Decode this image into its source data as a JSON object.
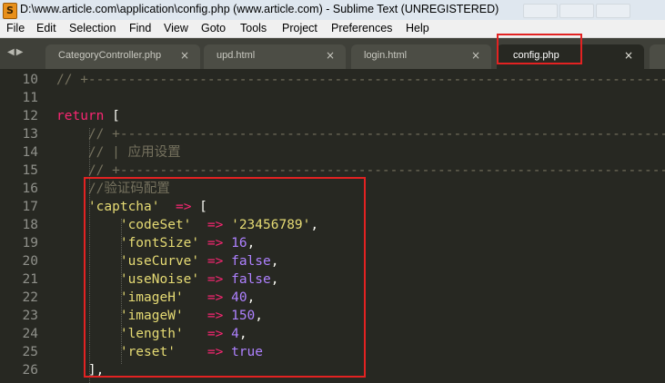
{
  "window": {
    "title": "D:\\www.article.com\\application\\config.php (www.article.com) - Sublime Text (UNREGISTERED)",
    "app_icon": "S"
  },
  "menu": [
    "File",
    "Edit",
    "Selection",
    "Find",
    "View",
    "Goto",
    "Tools",
    "Project",
    "Preferences",
    "Help"
  ],
  "tabs": [
    {
      "label": "CategoryController.php",
      "close": "×",
      "active": false
    },
    {
      "label": "upd.html",
      "close": "×",
      "active": false
    },
    {
      "label": "login.html",
      "close": "×",
      "active": false
    },
    {
      "label": "config.php",
      "close": "×",
      "active": true
    }
  ],
  "nav_arrows": "◀▶",
  "colors": {
    "comment": "#75715e",
    "keyword": "#f92672",
    "string": "#e6db74",
    "number": "#ae81ff",
    "plain": "#f8f8f2",
    "highlight": "#e32222"
  },
  "editor": {
    "lines": [
      {
        "n": "10",
        "tokens": [
          {
            "t": "// +-----------------------------------------------------------------------------",
            "c": "cm"
          }
        ]
      },
      {
        "n": "11",
        "tokens": []
      },
      {
        "n": "12",
        "tokens": [
          {
            "t": "return",
            "c": "kw"
          },
          {
            "t": " [",
            "c": "pl"
          }
        ]
      },
      {
        "n": "13",
        "tokens": [
          {
            "t": "    // +------------------------------------------------------------------------",
            "c": "cm"
          }
        ]
      },
      {
        "n": "14",
        "tokens": [
          {
            "t": "    // | 应用设置",
            "c": "cm"
          }
        ]
      },
      {
        "n": "15",
        "tokens": [
          {
            "t": "    // +------------------------------------------------------------------------",
            "c": "cm"
          }
        ]
      },
      {
        "n": "16",
        "tokens": [
          {
            "t": "    //验证码配置",
            "c": "cm"
          }
        ]
      },
      {
        "n": "17",
        "tokens": [
          {
            "t": "    ",
            "c": "pl"
          },
          {
            "t": "'captcha'",
            "c": "str"
          },
          {
            "t": "  ",
            "c": "pl"
          },
          {
            "t": "=>",
            "c": "op"
          },
          {
            "t": " [",
            "c": "pl"
          }
        ]
      },
      {
        "n": "18",
        "tokens": [
          {
            "t": "        ",
            "c": "pl"
          },
          {
            "t": "'codeSet'",
            "c": "str"
          },
          {
            "t": "  ",
            "c": "pl"
          },
          {
            "t": "=>",
            "c": "op"
          },
          {
            "t": " ",
            "c": "pl"
          },
          {
            "t": "'23456789'",
            "c": "str"
          },
          {
            "t": ",",
            "c": "pl"
          }
        ]
      },
      {
        "n": "19",
        "tokens": [
          {
            "t": "        ",
            "c": "pl"
          },
          {
            "t": "'fontSize'",
            "c": "str"
          },
          {
            "t": " ",
            "c": "pl"
          },
          {
            "t": "=>",
            "c": "op"
          },
          {
            "t": " ",
            "c": "pl"
          },
          {
            "t": "16",
            "c": "num"
          },
          {
            "t": ",",
            "c": "pl"
          }
        ]
      },
      {
        "n": "20",
        "tokens": [
          {
            "t": "        ",
            "c": "pl"
          },
          {
            "t": "'useCurve'",
            "c": "str"
          },
          {
            "t": " ",
            "c": "pl"
          },
          {
            "t": "=>",
            "c": "op"
          },
          {
            "t": " ",
            "c": "pl"
          },
          {
            "t": "false",
            "c": "num"
          },
          {
            "t": ",",
            "c": "pl"
          }
        ]
      },
      {
        "n": "21",
        "tokens": [
          {
            "t": "        ",
            "c": "pl"
          },
          {
            "t": "'useNoise'",
            "c": "str"
          },
          {
            "t": " ",
            "c": "pl"
          },
          {
            "t": "=>",
            "c": "op"
          },
          {
            "t": " ",
            "c": "pl"
          },
          {
            "t": "false",
            "c": "num"
          },
          {
            "t": ",",
            "c": "pl"
          }
        ]
      },
      {
        "n": "22",
        "tokens": [
          {
            "t": "        ",
            "c": "pl"
          },
          {
            "t": "'imageH'",
            "c": "str"
          },
          {
            "t": "   ",
            "c": "pl"
          },
          {
            "t": "=>",
            "c": "op"
          },
          {
            "t": " ",
            "c": "pl"
          },
          {
            "t": "40",
            "c": "num"
          },
          {
            "t": ",",
            "c": "pl"
          }
        ]
      },
      {
        "n": "23",
        "tokens": [
          {
            "t": "        ",
            "c": "pl"
          },
          {
            "t": "'imageW'",
            "c": "str"
          },
          {
            "t": "   ",
            "c": "pl"
          },
          {
            "t": "=>",
            "c": "op"
          },
          {
            "t": " ",
            "c": "pl"
          },
          {
            "t": "150",
            "c": "num"
          },
          {
            "t": ",",
            "c": "pl"
          }
        ]
      },
      {
        "n": "24",
        "tokens": [
          {
            "t": "        ",
            "c": "pl"
          },
          {
            "t": "'length'",
            "c": "str"
          },
          {
            "t": "   ",
            "c": "pl"
          },
          {
            "t": "=>",
            "c": "op"
          },
          {
            "t": " ",
            "c": "pl"
          },
          {
            "t": "4",
            "c": "num"
          },
          {
            "t": ",",
            "c": "pl"
          }
        ]
      },
      {
        "n": "25",
        "tokens": [
          {
            "t": "        ",
            "c": "pl"
          },
          {
            "t": "'reset'",
            "c": "str"
          },
          {
            "t": "    ",
            "c": "pl"
          },
          {
            "t": "=>",
            "c": "op"
          },
          {
            "t": " ",
            "c": "pl"
          },
          {
            "t": "true",
            "c": "num"
          }
        ]
      },
      {
        "n": "26",
        "tokens": [
          {
            "t": "    ],",
            "c": "pl"
          }
        ]
      }
    ]
  }
}
